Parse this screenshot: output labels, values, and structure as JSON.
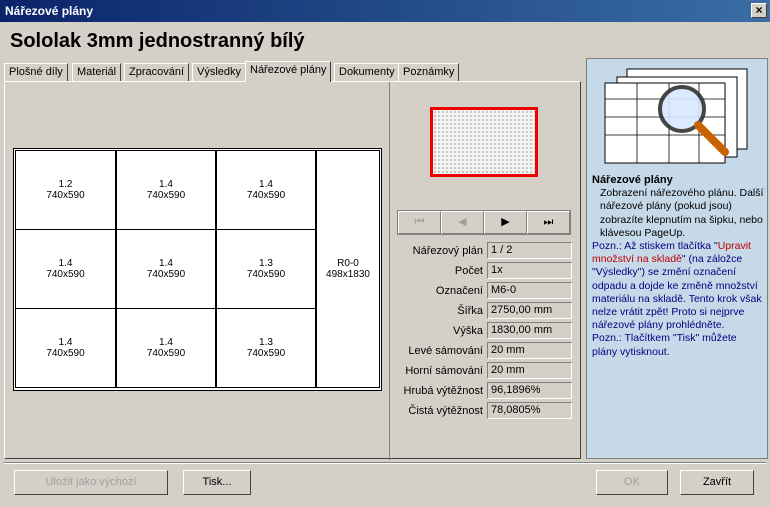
{
  "window": {
    "title": "Nářezové plány",
    "close": "×"
  },
  "heading": "Sololak 3mm jednostranný bílý",
  "tabs": [
    "Plošné díly",
    "Materiál",
    "Zpracování",
    "Výsledky",
    "Nářezové plány",
    "Dokumenty",
    "Poznámky"
  ],
  "active_tab": "Nářezové plány",
  "pieces": [
    {
      "id": "1.2",
      "size": "740x590"
    },
    {
      "id": "1.4",
      "size": "740x590"
    },
    {
      "id": "1.4",
      "size": "740x590"
    },
    {
      "id": "1.4",
      "size": "740x590"
    },
    {
      "id": "1.4",
      "size": "740x590"
    },
    {
      "id": "1.3",
      "size": "740x590"
    },
    {
      "id": "1.4",
      "size": "740x590"
    },
    {
      "id": "1.4",
      "size": "740x590"
    },
    {
      "id": "1.3",
      "size": "740x590"
    },
    {
      "id": "R0-0",
      "size": "498x1830"
    }
  ],
  "nav": {
    "first": "⏮",
    "prev": "◀",
    "next": "▶",
    "last": "⏭"
  },
  "info": [
    {
      "label": "Nářezový plán",
      "value": "1 / 2"
    },
    {
      "label": "Počet",
      "value": "1x"
    },
    {
      "label": "Označení",
      "value": "M6-0"
    },
    {
      "label": "Šířka",
      "value": "2750,00 mm"
    },
    {
      "label": "Výška",
      "value": "1830,00 mm"
    },
    {
      "label": "Levé sámování",
      "value": "20 mm"
    },
    {
      "label": "Horní sámování",
      "value": "20 mm"
    },
    {
      "label": "Hrubá výtěžnost",
      "value": "96,1896%"
    },
    {
      "label": "Čistá výtěžnost",
      "value": "78,0805%"
    }
  ],
  "help": {
    "title": "Nářezové plány",
    "p1": "Zobrazení nářezového plánu. Další nářezové plány (pokud jsou) zobrazíte klepnutím na šipku, nebo klávesou PageUp.",
    "note1_a": "Pozn.: Až stiskem tlačítka \"",
    "note1_link": "Upravit množství na skladě",
    "note1_b": "\" (na záložce \"Výsledky\") se změní označení odpadu a dojde ke změně množství materiálu na skladě. Tento krok však nelze vrátit zpět! Proto si nejprve nářezové plány prohlédněte.",
    "note2": "Pozn.: Tlačítkem \"Tisk\" můžete plány vytisknout."
  },
  "buttons": {
    "save_default": "Uložit jako výchozí",
    "print": "Tisk...",
    "ok": "OK",
    "close": "Zavřít"
  }
}
